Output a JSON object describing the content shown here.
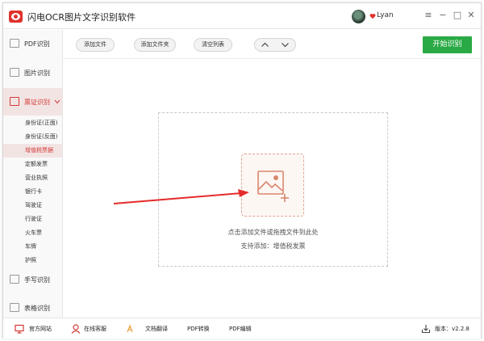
{
  "window": {
    "title": "闪电OCR图片文字识别软件"
  },
  "user": {
    "name": "Lyan"
  },
  "window_controls": {
    "menu": "≡",
    "minimize": "−",
    "maximize": "□",
    "close": "✕"
  },
  "toolbar": {
    "add_file": "添加文件",
    "add_folder": "添加文件夹",
    "clear_list": "清空列表",
    "start": "开始识别"
  },
  "sidebar": {
    "main": [
      {
        "label": "PDF识别"
      },
      {
        "label": "图片识别"
      },
      {
        "label": "票证识别"
      },
      {
        "label": "手写识别"
      },
      {
        "label": "表格识别"
      }
    ],
    "sub": [
      "身份证(正面)",
      "身份证(反面)",
      "增值税票据",
      "定额发票",
      "营业执照",
      "银行卡",
      "驾驶证",
      "行驶证",
      "火车票",
      "车牌",
      "护照"
    ],
    "active_sub_index": 2
  },
  "dropzone": {
    "hint": "点击添加文件或拖拽文件到此处",
    "support": "支持添加：增值税发票"
  },
  "status": {
    "website": "官方网站",
    "support": "在线客服",
    "translate": "文档翻译",
    "pdf_convert": "PDF转换",
    "pdf_edit": "PDF编辑",
    "version": "版本：v2.2.8"
  },
  "colors": {
    "accent_red": "#d23b36",
    "start_green": "#2aaa45",
    "upload_tint": "#e1a58f"
  },
  "icons": [
    "app-logo",
    "avatar",
    "heart-icon",
    "menu-icon",
    "minimize-icon",
    "maximize-icon",
    "close-icon",
    "up-icon",
    "down-icon",
    "image-add-icon",
    "monitor-icon",
    "headset-icon",
    "translate-icon",
    "download-icon"
  ]
}
